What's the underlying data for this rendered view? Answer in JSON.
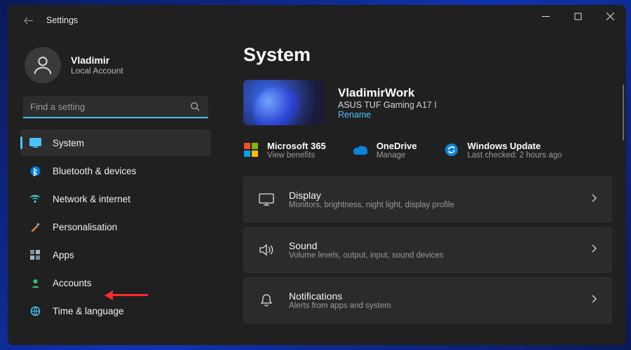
{
  "window": {
    "title": "Settings"
  },
  "user": {
    "name": "Vladimir",
    "subtitle": "Local Account"
  },
  "search": {
    "placeholder": "Find a setting"
  },
  "sidebar": {
    "items": [
      {
        "label": "System"
      },
      {
        "label": "Bluetooth & devices"
      },
      {
        "label": "Network & internet"
      },
      {
        "label": "Personalisation"
      },
      {
        "label": "Apps"
      },
      {
        "label": "Accounts"
      },
      {
        "label": "Time & language"
      }
    ]
  },
  "page": {
    "title": "System"
  },
  "device": {
    "name": "VladimirWork",
    "model": "ASUS TUF Gaming A17 I",
    "rename": "Rename"
  },
  "services": {
    "ms365": {
      "title": "Microsoft 365",
      "sub": "View benefits"
    },
    "onedrive": {
      "title": "OneDrive",
      "sub": "Manage"
    },
    "winupdate": {
      "title": "Windows Update",
      "sub": "Last checked: 2 hours ago"
    }
  },
  "tiles": [
    {
      "title": "Display",
      "sub": "Monitors, brightness, night light, display profile"
    },
    {
      "title": "Sound",
      "sub": "Volume levels, output, input, sound devices"
    },
    {
      "title": "Notifications",
      "sub": "Alerts from apps and system"
    }
  ]
}
